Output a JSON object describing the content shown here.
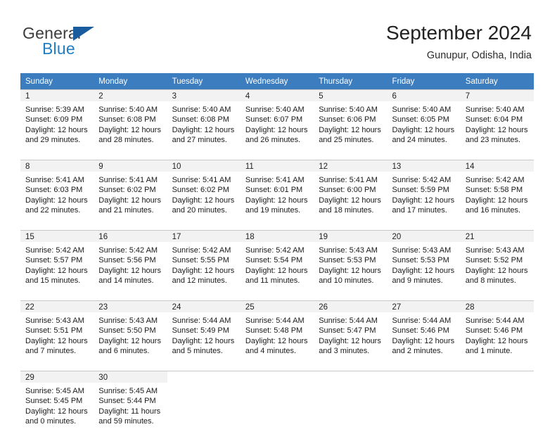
{
  "brand": {
    "name_part1": "General",
    "name_part2": "Blue",
    "flag_icon": "triangle-flag-icon"
  },
  "header": {
    "title": "September 2024",
    "subtitle": "Gunupur, Odisha, India"
  },
  "theme": {
    "header_bg": "#3b7dbf",
    "daynum_bg": "#f2f2f2",
    "brand_blue": "#1f7ec4",
    "flag_blue": "#1a5d9e",
    "grid_line": "#c8c8c8"
  },
  "weekdays": [
    "Sunday",
    "Monday",
    "Tuesday",
    "Wednesday",
    "Thursday",
    "Friday",
    "Saturday"
  ],
  "labels": {
    "sunrise": "Sunrise:",
    "sunset": "Sunset:",
    "daylight": "Daylight:"
  },
  "weeks": [
    [
      {
        "day": "1",
        "sunrise": "Sunrise: 5:39 AM",
        "sunset": "Sunset: 6:09 PM",
        "daylight1": "Daylight: 12 hours",
        "daylight2": "and 29 minutes."
      },
      {
        "day": "2",
        "sunrise": "Sunrise: 5:40 AM",
        "sunset": "Sunset: 6:08 PM",
        "daylight1": "Daylight: 12 hours",
        "daylight2": "and 28 minutes."
      },
      {
        "day": "3",
        "sunrise": "Sunrise: 5:40 AM",
        "sunset": "Sunset: 6:08 PM",
        "daylight1": "Daylight: 12 hours",
        "daylight2": "and 27 minutes."
      },
      {
        "day": "4",
        "sunrise": "Sunrise: 5:40 AM",
        "sunset": "Sunset: 6:07 PM",
        "daylight1": "Daylight: 12 hours",
        "daylight2": "and 26 minutes."
      },
      {
        "day": "5",
        "sunrise": "Sunrise: 5:40 AM",
        "sunset": "Sunset: 6:06 PM",
        "daylight1": "Daylight: 12 hours",
        "daylight2": "and 25 minutes."
      },
      {
        "day": "6",
        "sunrise": "Sunrise: 5:40 AM",
        "sunset": "Sunset: 6:05 PM",
        "daylight1": "Daylight: 12 hours",
        "daylight2": "and 24 minutes."
      },
      {
        "day": "7",
        "sunrise": "Sunrise: 5:40 AM",
        "sunset": "Sunset: 6:04 PM",
        "daylight1": "Daylight: 12 hours",
        "daylight2": "and 23 minutes."
      }
    ],
    [
      {
        "day": "8",
        "sunrise": "Sunrise: 5:41 AM",
        "sunset": "Sunset: 6:03 PM",
        "daylight1": "Daylight: 12 hours",
        "daylight2": "and 22 minutes."
      },
      {
        "day": "9",
        "sunrise": "Sunrise: 5:41 AM",
        "sunset": "Sunset: 6:02 PM",
        "daylight1": "Daylight: 12 hours",
        "daylight2": "and 21 minutes."
      },
      {
        "day": "10",
        "sunrise": "Sunrise: 5:41 AM",
        "sunset": "Sunset: 6:02 PM",
        "daylight1": "Daylight: 12 hours",
        "daylight2": "and 20 minutes."
      },
      {
        "day": "11",
        "sunrise": "Sunrise: 5:41 AM",
        "sunset": "Sunset: 6:01 PM",
        "daylight1": "Daylight: 12 hours",
        "daylight2": "and 19 minutes."
      },
      {
        "day": "12",
        "sunrise": "Sunrise: 5:41 AM",
        "sunset": "Sunset: 6:00 PM",
        "daylight1": "Daylight: 12 hours",
        "daylight2": "and 18 minutes."
      },
      {
        "day": "13",
        "sunrise": "Sunrise: 5:42 AM",
        "sunset": "Sunset: 5:59 PM",
        "daylight1": "Daylight: 12 hours",
        "daylight2": "and 17 minutes."
      },
      {
        "day": "14",
        "sunrise": "Sunrise: 5:42 AM",
        "sunset": "Sunset: 5:58 PM",
        "daylight1": "Daylight: 12 hours",
        "daylight2": "and 16 minutes."
      }
    ],
    [
      {
        "day": "15",
        "sunrise": "Sunrise: 5:42 AM",
        "sunset": "Sunset: 5:57 PM",
        "daylight1": "Daylight: 12 hours",
        "daylight2": "and 15 minutes."
      },
      {
        "day": "16",
        "sunrise": "Sunrise: 5:42 AM",
        "sunset": "Sunset: 5:56 PM",
        "daylight1": "Daylight: 12 hours",
        "daylight2": "and 14 minutes."
      },
      {
        "day": "17",
        "sunrise": "Sunrise: 5:42 AM",
        "sunset": "Sunset: 5:55 PM",
        "daylight1": "Daylight: 12 hours",
        "daylight2": "and 12 minutes."
      },
      {
        "day": "18",
        "sunrise": "Sunrise: 5:42 AM",
        "sunset": "Sunset: 5:54 PM",
        "daylight1": "Daylight: 12 hours",
        "daylight2": "and 11 minutes."
      },
      {
        "day": "19",
        "sunrise": "Sunrise: 5:43 AM",
        "sunset": "Sunset: 5:53 PM",
        "daylight1": "Daylight: 12 hours",
        "daylight2": "and 10 minutes."
      },
      {
        "day": "20",
        "sunrise": "Sunrise: 5:43 AM",
        "sunset": "Sunset: 5:53 PM",
        "daylight1": "Daylight: 12 hours",
        "daylight2": "and 9 minutes."
      },
      {
        "day": "21",
        "sunrise": "Sunrise: 5:43 AM",
        "sunset": "Sunset: 5:52 PM",
        "daylight1": "Daylight: 12 hours",
        "daylight2": "and 8 minutes."
      }
    ],
    [
      {
        "day": "22",
        "sunrise": "Sunrise: 5:43 AM",
        "sunset": "Sunset: 5:51 PM",
        "daylight1": "Daylight: 12 hours",
        "daylight2": "and 7 minutes."
      },
      {
        "day": "23",
        "sunrise": "Sunrise: 5:43 AM",
        "sunset": "Sunset: 5:50 PM",
        "daylight1": "Daylight: 12 hours",
        "daylight2": "and 6 minutes."
      },
      {
        "day": "24",
        "sunrise": "Sunrise: 5:44 AM",
        "sunset": "Sunset: 5:49 PM",
        "daylight1": "Daylight: 12 hours",
        "daylight2": "and 5 minutes."
      },
      {
        "day": "25",
        "sunrise": "Sunrise: 5:44 AM",
        "sunset": "Sunset: 5:48 PM",
        "daylight1": "Daylight: 12 hours",
        "daylight2": "and 4 minutes."
      },
      {
        "day": "26",
        "sunrise": "Sunrise: 5:44 AM",
        "sunset": "Sunset: 5:47 PM",
        "daylight1": "Daylight: 12 hours",
        "daylight2": "and 3 minutes."
      },
      {
        "day": "27",
        "sunrise": "Sunrise: 5:44 AM",
        "sunset": "Sunset: 5:46 PM",
        "daylight1": "Daylight: 12 hours",
        "daylight2": "and 2 minutes."
      },
      {
        "day": "28",
        "sunrise": "Sunrise: 5:44 AM",
        "sunset": "Sunset: 5:46 PM",
        "daylight1": "Daylight: 12 hours",
        "daylight2": "and 1 minute."
      }
    ],
    [
      {
        "day": "29",
        "sunrise": "Sunrise: 5:45 AM",
        "sunset": "Sunset: 5:45 PM",
        "daylight1": "Daylight: 12 hours",
        "daylight2": "and 0 minutes."
      },
      {
        "day": "30",
        "sunrise": "Sunrise: 5:45 AM",
        "sunset": "Sunset: 5:44 PM",
        "daylight1": "Daylight: 11 hours",
        "daylight2": "and 59 minutes."
      },
      {
        "day": "",
        "sunrise": "",
        "sunset": "",
        "daylight1": "",
        "daylight2": ""
      },
      {
        "day": "",
        "sunrise": "",
        "sunset": "",
        "daylight1": "",
        "daylight2": ""
      },
      {
        "day": "",
        "sunrise": "",
        "sunset": "",
        "daylight1": "",
        "daylight2": ""
      },
      {
        "day": "",
        "sunrise": "",
        "sunset": "",
        "daylight1": "",
        "daylight2": ""
      },
      {
        "day": "",
        "sunrise": "",
        "sunset": "",
        "daylight1": "",
        "daylight2": ""
      }
    ]
  ]
}
